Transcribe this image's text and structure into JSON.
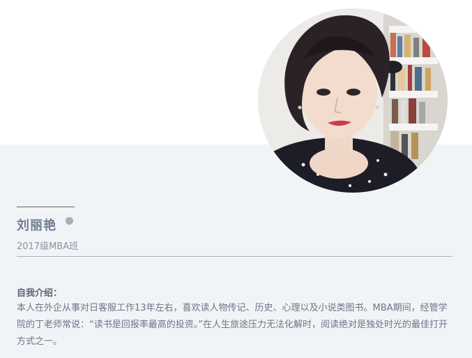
{
  "profile": {
    "name": "刘丽艳",
    "class": "2017级MBA班",
    "intro_title": "自我介绍：",
    "intro_text": "本人在外企从事对日客服工作13年左右，喜欢读人物传记、历史、心理以及小说类图书。MBA期间，经管学院的丁老师常说：“读书是回报率最高的投资。”在人生旅途压力无法化解时，阅读绝对是独处时光的最佳打开方式之一。"
  },
  "colors": {
    "lower_background": "#f1f4f7",
    "name_text": "#6f7b8f",
    "dot": "#a7afbb",
    "body_text": "#6b7585"
  }
}
